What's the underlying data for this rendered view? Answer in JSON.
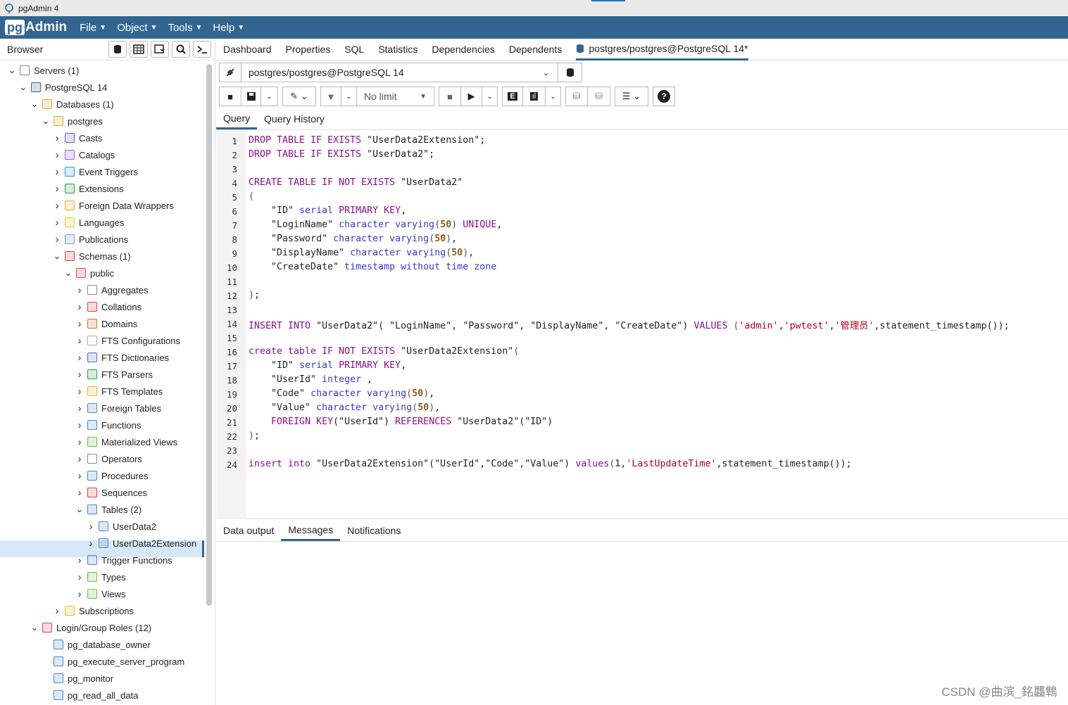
{
  "window": {
    "title": "pgAdmin 4"
  },
  "menubar": {
    "logo_pg": "pg",
    "logo_admin": "Admin",
    "items": [
      "File",
      "Object",
      "Tools",
      "Help"
    ]
  },
  "browser": {
    "title": "Browser",
    "tree": [
      {
        "label": "Servers (1)",
        "icon": "servers-icon",
        "toggle": "open",
        "depth": 0
      },
      {
        "label": "PostgreSQL 14",
        "icon": "elephant-icon",
        "toggle": "open",
        "depth": 1
      },
      {
        "label": "Databases (1)",
        "icon": "databases-icon",
        "toggle": "open",
        "depth": 2
      },
      {
        "label": "postgres",
        "icon": "database-icon",
        "toggle": "open",
        "depth": 3
      },
      {
        "label": "Casts",
        "icon": "casts-icon",
        "toggle": "closed",
        "depth": 4
      },
      {
        "label": "Catalogs",
        "icon": "catalogs-icon",
        "toggle": "closed",
        "depth": 4
      },
      {
        "label": "Event Triggers",
        "icon": "event-triggers-icon",
        "toggle": "closed",
        "depth": 4
      },
      {
        "label": "Extensions",
        "icon": "extensions-icon",
        "toggle": "closed",
        "depth": 4
      },
      {
        "label": "Foreign Data Wrappers",
        "icon": "foreign-data-wrappers-icon",
        "toggle": "closed",
        "depth": 4
      },
      {
        "label": "Languages",
        "icon": "languages-icon",
        "toggle": "closed",
        "depth": 4
      },
      {
        "label": "Publications",
        "icon": "publications-icon",
        "toggle": "closed",
        "depth": 4
      },
      {
        "label": "Schemas (1)",
        "icon": "schemas-icon",
        "toggle": "open",
        "depth": 4
      },
      {
        "label": "public",
        "icon": "schema-icon",
        "toggle": "open",
        "depth": 5
      },
      {
        "label": "Aggregates",
        "icon": "aggregates-icon",
        "toggle": "closed",
        "depth": 6
      },
      {
        "label": "Collations",
        "icon": "collations-icon",
        "toggle": "closed",
        "depth": 6
      },
      {
        "label": "Domains",
        "icon": "domains-icon",
        "toggle": "closed",
        "depth": 6
      },
      {
        "label": "FTS Configurations",
        "icon": "fts-configurations-icon",
        "toggle": "closed",
        "depth": 6
      },
      {
        "label": "FTS Dictionaries",
        "icon": "fts-dictionaries-icon",
        "toggle": "closed",
        "depth": 6
      },
      {
        "label": "FTS Parsers",
        "icon": "fts-parsers-icon",
        "toggle": "closed",
        "depth": 6
      },
      {
        "label": "FTS Templates",
        "icon": "fts-templates-icon",
        "toggle": "closed",
        "depth": 6
      },
      {
        "label": "Foreign Tables",
        "icon": "foreign-tables-icon",
        "toggle": "closed",
        "depth": 6
      },
      {
        "label": "Functions",
        "icon": "functions-icon",
        "toggle": "closed",
        "depth": 6
      },
      {
        "label": "Materialized Views",
        "icon": "materialized-views-icon",
        "toggle": "closed",
        "depth": 6
      },
      {
        "label": "Operators",
        "icon": "operators-icon",
        "toggle": "closed",
        "depth": 6
      },
      {
        "label": "Procedures",
        "icon": "procedures-icon",
        "toggle": "closed",
        "depth": 6
      },
      {
        "label": "Sequences",
        "icon": "sequences-icon",
        "toggle": "closed",
        "depth": 6
      },
      {
        "label": "Tables (2)",
        "icon": "tables-icon",
        "toggle": "open",
        "depth": 6
      },
      {
        "label": "UserData2",
        "icon": "table-icon",
        "toggle": "closed",
        "depth": 7,
        "selected": true
      },
      {
        "label": "UserData2Extension",
        "icon": "table-icon",
        "toggle": "closed",
        "depth": 7
      },
      {
        "label": "Trigger Functions",
        "icon": "trigger-functions-icon",
        "toggle": "closed",
        "depth": 6
      },
      {
        "label": "Types",
        "icon": "types-icon",
        "toggle": "closed",
        "depth": 6
      },
      {
        "label": "Views",
        "icon": "views-icon",
        "toggle": "closed",
        "depth": 6
      },
      {
        "label": "Subscriptions",
        "icon": "subscriptions-icon",
        "toggle": "closed",
        "depth": 4
      },
      {
        "label": "Login/Group Roles (12)",
        "icon": "roles-icon",
        "toggle": "open",
        "depth": 2
      },
      {
        "label": "pg_database_owner",
        "icon": "role-icon",
        "toggle": "none",
        "depth": 3
      },
      {
        "label": "pg_execute_server_program",
        "icon": "role-icon",
        "toggle": "none",
        "depth": 3
      },
      {
        "label": "pg_monitor",
        "icon": "role-icon",
        "toggle": "none",
        "depth": 3
      },
      {
        "label": "pg_read_all_data",
        "icon": "role-icon",
        "toggle": "none",
        "depth": 3
      }
    ]
  },
  "main_tabs": [
    "Dashboard",
    "Properties",
    "SQL",
    "Statistics",
    "Dependencies",
    "Dependents",
    "postgres/postgres@PostgreSQL 14*"
  ],
  "connection": {
    "value": "postgres/postgres@PostgreSQL 14"
  },
  "toolbar": {
    "limit_label": "No limit"
  },
  "query_tabs": [
    "Query",
    "Query History"
  ],
  "output_tabs": [
    "Data output",
    "Messages",
    "Notifications"
  ],
  "editor": {
    "line_numbers": [
      "1",
      "2",
      "3",
      "4",
      "5",
      "6",
      "7",
      "8",
      "9",
      "10",
      "11",
      "12",
      "13",
      "14",
      "15",
      "16",
      "17",
      "18",
      "19",
      "20",
      "21",
      "22",
      "23",
      "24"
    ]
  },
  "watermark": "CSDN @曲滨_銘龘鶽",
  "colors": {
    "menubar": "#326690",
    "selected_row": "#d7e8f8",
    "keyword": "#8b1089",
    "type": "#3a3ad0",
    "string": "#b00020"
  }
}
